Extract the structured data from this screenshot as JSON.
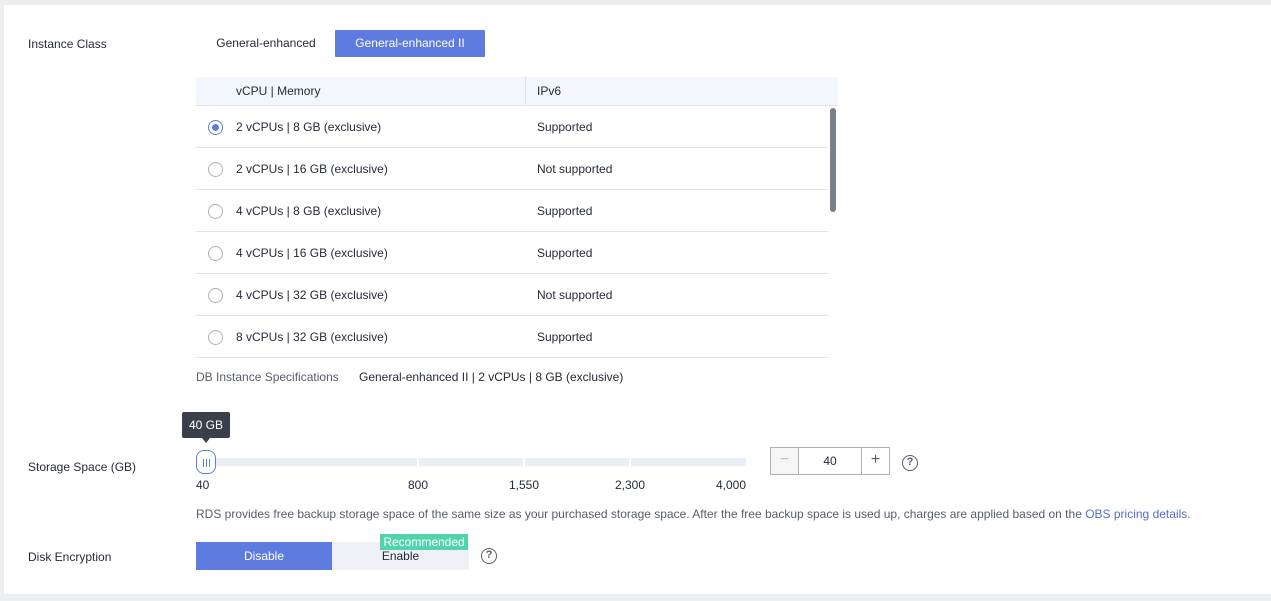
{
  "instance_class": {
    "label": "Instance Class",
    "tabs": [
      {
        "label": "General-enhanced",
        "active": false
      },
      {
        "label": "General-enhanced II",
        "active": true
      }
    ]
  },
  "table": {
    "headers": [
      "vCPU | Memory",
      "IPv6"
    ],
    "rows": [
      {
        "spec": "2 vCPUs | 8 GB (exclusive)",
        "ipv6": "Supported",
        "selected": true
      },
      {
        "spec": "2 vCPUs | 16 GB (exclusive)",
        "ipv6": "Not supported",
        "selected": false
      },
      {
        "spec": "4 vCPUs | 8 GB (exclusive)",
        "ipv6": "Supported",
        "selected": false
      },
      {
        "spec": "4 vCPUs | 16 GB (exclusive)",
        "ipv6": "Supported",
        "selected": false
      },
      {
        "spec": "4 vCPUs | 32 GB (exclusive)",
        "ipv6": "Not supported",
        "selected": false
      },
      {
        "spec": "8 vCPUs | 32 GB (exclusive)",
        "ipv6": "Supported",
        "selected": false
      }
    ]
  },
  "specification": {
    "label": "DB Instance Specifications",
    "value": "General-enhanced II | 2 vCPUs | 8 GB (exclusive)"
  },
  "storage": {
    "label": "Storage Space (GB)",
    "tooltip": "40 GB",
    "ticks": [
      "40",
      "800",
      "1,550",
      "2,300",
      "4,000"
    ],
    "value": "40",
    "minus": "−",
    "plus": "+",
    "help": "?",
    "note_text": "RDS provides free backup storage space of the same size as your purchased storage space. After the free backup space is used up, charges are applied based on the ",
    "note_link": "OBS pricing details",
    "note_end": "."
  },
  "encryption": {
    "label": "Disk Encryption",
    "options": [
      "Disable",
      "Enable"
    ],
    "selected": "Disable",
    "badge": "Recommended",
    "help": "?"
  },
  "colors": {
    "accent": "#5e7ce0",
    "badge": "#50d4ab",
    "link": "#526ecc"
  }
}
